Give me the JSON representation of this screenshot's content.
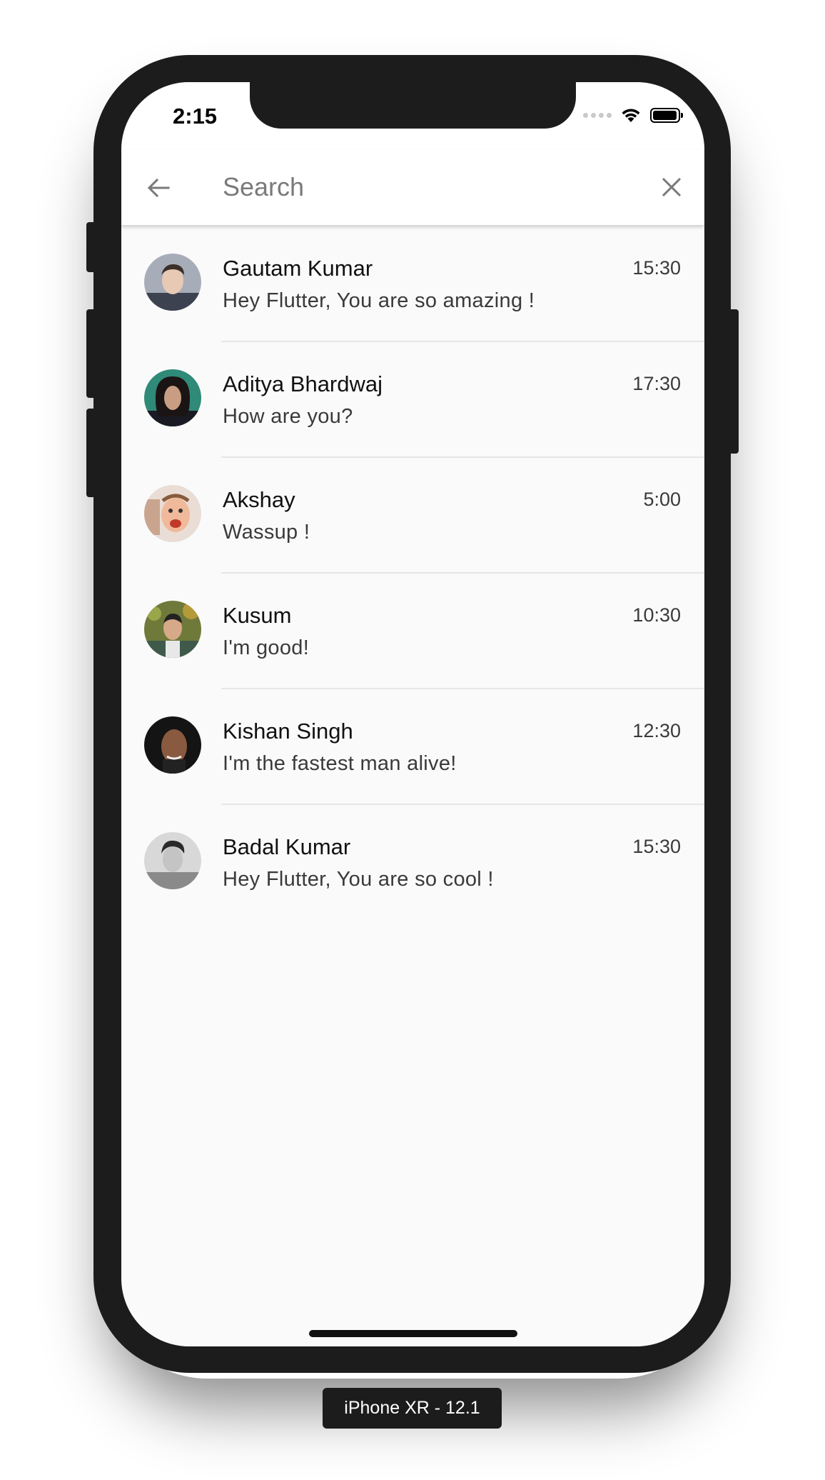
{
  "status_bar": {
    "time": "2:15"
  },
  "search": {
    "placeholder": "Search",
    "value": ""
  },
  "icons": {
    "back": "arrow-back-icon",
    "close": "close-icon",
    "wifi": "wifi-icon",
    "battery": "battery-icon",
    "signal": "signal-icon"
  },
  "chats": [
    {
      "name": "Gautam Kumar",
      "message": "Hey Flutter, You are so amazing !",
      "time": "15:30",
      "avatar": "avatar-gautam"
    },
    {
      "name": "Aditya Bhardwaj",
      "message": "How are you?",
      "time": "17:30",
      "avatar": "avatar-aditya"
    },
    {
      "name": "Akshay",
      "message": "Wassup !",
      "time": "5:00",
      "avatar": "avatar-akshay"
    },
    {
      "name": "Kusum",
      "message": "I'm good!",
      "time": "10:30",
      "avatar": "avatar-kusum"
    },
    {
      "name": "Kishan Singh",
      "message": "I'm the fastest man alive!",
      "time": "12:30",
      "avatar": "avatar-kishan"
    },
    {
      "name": "Badal Kumar",
      "message": "Hey Flutter, You are so cool !",
      "time": "15:30",
      "avatar": "avatar-badal"
    }
  ],
  "device_label": "iPhone XR - 12.1",
  "colors": {
    "screen_background": "#fafafa",
    "app_bar": "#ffffff",
    "frame": "#1c1c1c",
    "divider": "#e6e6e6"
  }
}
